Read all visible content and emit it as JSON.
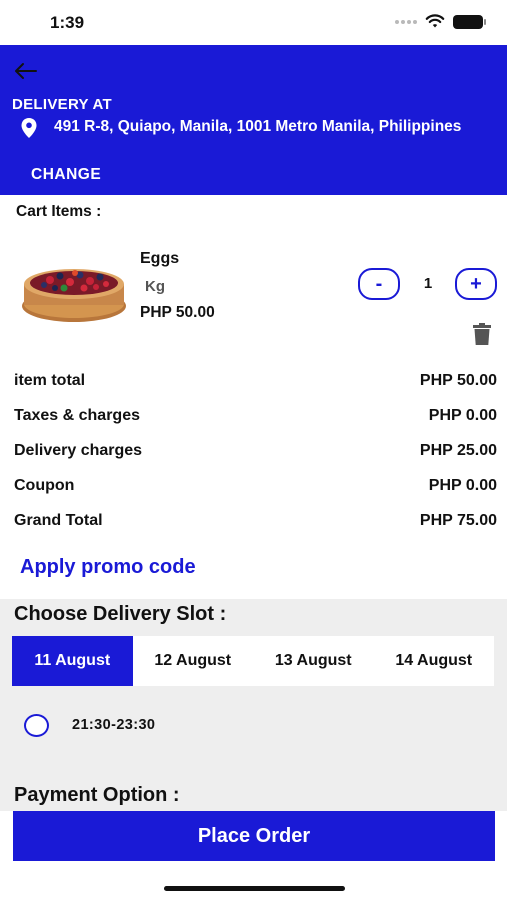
{
  "status_bar": {
    "time": "1:39"
  },
  "header": {
    "delivery_label": "DELIVERY AT",
    "address": "491 R-8, Quiapo, Manila, 1001 Metro Manila, Philippines",
    "change_label": "CHANGE",
    "background_color": "#1a1ad6"
  },
  "cart": {
    "title": "Cart Items :",
    "items": [
      {
        "name": "Eggs",
        "unit": "Kg",
        "price": "PHP 50.00",
        "quantity": "1",
        "minus_label": "-",
        "plus_label": "+"
      }
    ]
  },
  "summary": [
    {
      "label": "item total",
      "value": "PHP 50.00"
    },
    {
      "label": "Taxes & charges",
      "value": "PHP 0.00"
    },
    {
      "label": "Delivery charges",
      "value": "PHP 25.00"
    },
    {
      "label": "Coupon",
      "value": "PHP 0.00"
    },
    {
      "label": "Grand Total",
      "value": "PHP 75.00"
    }
  ],
  "promo": {
    "label": "Apply promo code"
  },
  "delivery_slot": {
    "title": "Choose Delivery Slot :",
    "dates": [
      "11 August",
      "12 August",
      "13 August",
      "14 August"
    ],
    "selected_date": "11 August",
    "times": [
      "21:30-23:30"
    ]
  },
  "payment": {
    "title": "Payment Option :"
  },
  "place_order": {
    "label": "Place Order"
  },
  "colors": {
    "accent": "#1a1ad6",
    "slot_background": "#eeeeee"
  }
}
